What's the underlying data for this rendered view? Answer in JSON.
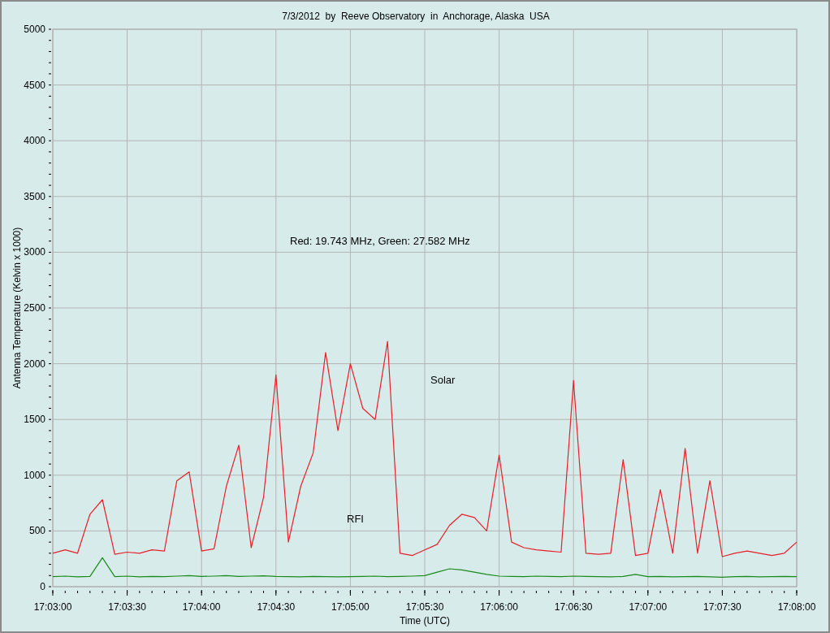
{
  "chart": {
    "chart_data": {
      "type": "line",
      "title": "7/3/2012  by  Reeve Observatory  in  Anchorage, Alaska  USA",
      "xlabel": "Time (UTC)",
      "ylabel": "Antenna Temperature (Kelvin x 1000)",
      "categories": [
        "17:03:00",
        null,
        null,
        null,
        null,
        null,
        "17:03:30",
        null,
        null,
        null,
        null,
        null,
        "17:04:00",
        null,
        null,
        null,
        null,
        null,
        "17:04:30",
        null,
        null,
        null,
        null,
        null,
        "17:05:00",
        null,
        null,
        null,
        null,
        null,
        "17:05:30",
        null,
        null,
        null,
        null,
        null,
        "17:06:00",
        null,
        null,
        null,
        null,
        null,
        "17:06:30",
        null,
        null,
        null,
        null,
        null,
        "17:07:00",
        null,
        null,
        null,
        null,
        null,
        "17:07:30",
        null,
        null,
        null,
        null,
        null,
        "17:08:00"
      ],
      "series": [
        {
          "color": "#e8202a",
          "values": [
            300,
            330,
            300,
            650,
            780,
            290,
            310,
            300,
            330,
            320,
            950,
            1030,
            320,
            340,
            900,
            1270,
            350,
            800,
            1900,
            400,
            900,
            1200,
            2100,
            1400,
            2000,
            1600,
            1500,
            2200,
            300,
            280,
            330,
            380,
            550,
            650,
            620,
            500,
            1180,
            400,
            350,
            330,
            320,
            310,
            1850,
            300,
            290,
            300,
            1140,
            280,
            300,
            870,
            300,
            1240,
            300,
            950,
            270,
            300,
            320,
            300,
            280,
            300,
            400
          ]
        },
        {
          "color": "#1a8a1a",
          "values": [
            90,
            95,
            88,
            92,
            260,
            90,
            95,
            88,
            92,
            90,
            95,
            100,
            92,
            95,
            100,
            92,
            95,
            98,
            92,
            90,
            88,
            92,
            90,
            88,
            90,
            92,
            95,
            90,
            92,
            95,
            100,
            130,
            160,
            150,
            130,
            110,
            95,
            92,
            90,
            95,
            92,
            90,
            95,
            92,
            90,
            88,
            92,
            110,
            90,
            92,
            88,
            90,
            92,
            88,
            85,
            90,
            92,
            88,
            90,
            92,
            90
          ]
        }
      ],
      "ylim": [
        0,
        5000
      ],
      "grid": true,
      "yticks": [
        0,
        500,
        1000,
        1500,
        2000,
        2500,
        3000,
        3500,
        4000,
        4500,
        5000
      ],
      "annotations": [
        "Red: 19.743 MHz, Green: 27.582 MHz",
        "Solar",
        "RFI"
      ]
    }
  }
}
